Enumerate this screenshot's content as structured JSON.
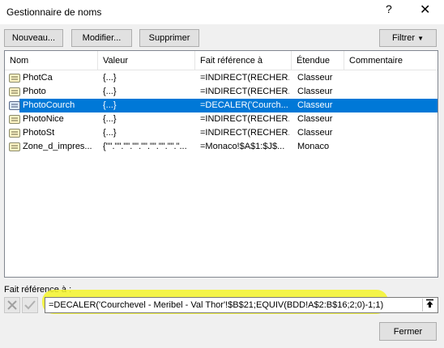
{
  "window": {
    "title": "Gestionnaire de noms",
    "help_icon": "?",
    "close_icon": "✕"
  },
  "toolbar": {
    "nouveau": "Nouveau...",
    "modifier": "Modifier...",
    "supprimer": "Supprimer",
    "filtrer": "Filtrer",
    "filtrer_caret": "▼"
  },
  "columns": {
    "nom": "Nom",
    "valeur": "Valeur",
    "fait_reference": "Fait référence à",
    "etendue": "Étendue",
    "commentaire": "Commentaire"
  },
  "rows": [
    {
      "nom": "PhotCa",
      "valeur": "{...}",
      "ref": "=INDIRECT(RECHER...",
      "etendue": "Classeur",
      "commentaire": "",
      "icon": "named-range-icon"
    },
    {
      "nom": "Photo",
      "valeur": "{...}",
      "ref": "=INDIRECT(RECHER...",
      "etendue": "Classeur",
      "commentaire": "",
      "icon": "named-range-icon"
    },
    {
      "nom": "PhotoCourch",
      "valeur": "{...}",
      "ref": "=DECALER('Courch...",
      "etendue": "Classeur",
      "commentaire": "",
      "icon": "named-range-icon",
      "selected": true
    },
    {
      "nom": "PhotoNice",
      "valeur": "{...}",
      "ref": "=INDIRECT(RECHER...",
      "etendue": "Classeur",
      "commentaire": "",
      "icon": "named-range-icon"
    },
    {
      "nom": "PhotoSt",
      "valeur": "{...}",
      "ref": "=INDIRECT(RECHER...",
      "etendue": "Classeur",
      "commentaire": "",
      "icon": "named-range-icon"
    },
    {
      "nom": "Zone_d_impres...",
      "valeur": "{\"\".\"\".\"\".\"\".\"\".\"\".\"\".\"\".\"...",
      "ref": "=Monaco!$A$1:$J$...",
      "etendue": "Monaco",
      "commentaire": "",
      "icon": "named-range-icon"
    }
  ],
  "reference": {
    "label": "Fait référence à :",
    "value": "=DECALER('Courchevel - Meribel - Val Thor'!$B$21;EQUIV(BDD!A$2:B$16;2;0)-1;1)",
    "cancel_icon": "✕",
    "confirm_icon": "✓",
    "collapse_icon": "🠕"
  },
  "footer": {
    "fermer": "Fermer"
  },
  "colors": {
    "selection": "#0078d7",
    "highlight": "#f5f52a"
  }
}
